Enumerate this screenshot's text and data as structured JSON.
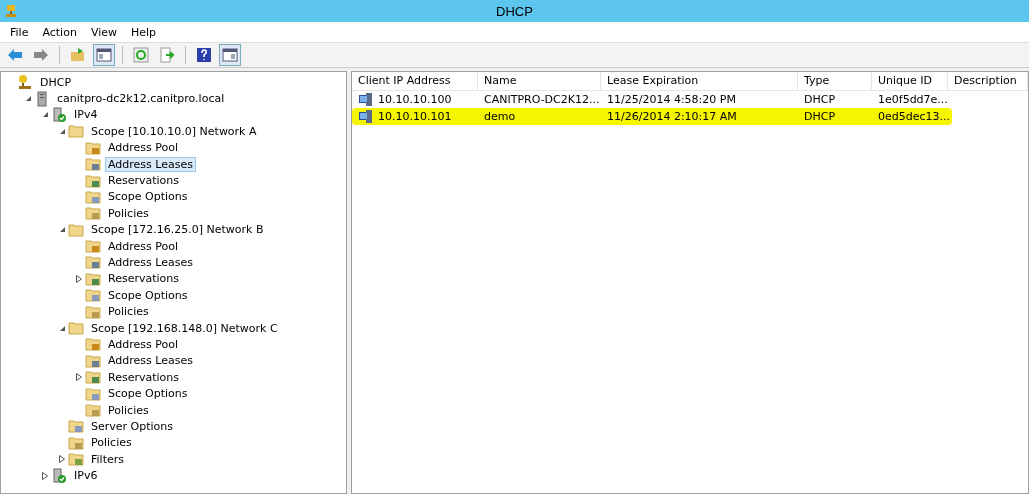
{
  "window": {
    "title": "DHCP"
  },
  "menu": [
    "File",
    "Action",
    "View",
    "Help"
  ],
  "toolbar": [
    {
      "kind": "back"
    },
    {
      "kind": "forward"
    },
    {
      "kind": "up-folder"
    },
    {
      "kind": "pane",
      "selected": true
    },
    {
      "kind": "refresh"
    },
    {
      "kind": "export"
    },
    {
      "kind": "help"
    },
    {
      "kind": "pane-right",
      "selected": true
    }
  ],
  "tree": [
    {
      "label": "DHCP",
      "kind": "dhcp",
      "selected": false,
      "children": [
        {
          "label": "canitpro-dc2k12.canitpro.local",
          "kind": "server",
          "expanded": true,
          "selected": false,
          "children": [
            {
              "label": "IPv4",
              "kind": "ip",
              "expanded": true,
              "selected": false,
              "children": [
                {
                  "label": "Scope [10.10.10.0] Network A",
                  "kind": "scope",
                  "expanded": true,
                  "selected": false,
                  "children": [
                    {
                      "label": "Address Pool",
                      "kind": "pool",
                      "selected": false
                    },
                    {
                      "label": "Address Leases",
                      "kind": "leases",
                      "selected": true
                    },
                    {
                      "label": "Reservations",
                      "kind": "reservations",
                      "selected": false
                    },
                    {
                      "label": "Scope Options",
                      "kind": "options",
                      "selected": false
                    },
                    {
                      "label": "Policies",
                      "kind": "policies",
                      "selected": false
                    }
                  ]
                },
                {
                  "label": "Scope [172.16.25.0] Network B",
                  "kind": "scope",
                  "expanded": true,
                  "selected": false,
                  "children": [
                    {
                      "label": "Address Pool",
                      "kind": "pool",
                      "selected": false
                    },
                    {
                      "label": "Address Leases",
                      "kind": "leases",
                      "selected": false
                    },
                    {
                      "label": "Reservations",
                      "kind": "reservations",
                      "expanded": false,
                      "selected": false
                    },
                    {
                      "label": "Scope Options",
                      "kind": "options",
                      "selected": false
                    },
                    {
                      "label": "Policies",
                      "kind": "policies",
                      "selected": false
                    }
                  ]
                },
                {
                  "label": "Scope [192.168.148.0] Network C",
                  "kind": "scope",
                  "expanded": true,
                  "selected": false,
                  "children": [
                    {
                      "label": "Address Pool",
                      "kind": "pool",
                      "selected": false
                    },
                    {
                      "label": "Address Leases",
                      "kind": "leases",
                      "selected": false
                    },
                    {
                      "label": "Reservations",
                      "kind": "reservations",
                      "expanded": false,
                      "selected": false
                    },
                    {
                      "label": "Scope Options",
                      "kind": "options",
                      "selected": false
                    },
                    {
                      "label": "Policies",
                      "kind": "policies",
                      "selected": false
                    }
                  ]
                },
                {
                  "label": "Server Options",
                  "kind": "options",
                  "selected": false
                },
                {
                  "label": "Policies",
                  "kind": "policies",
                  "selected": false
                },
                {
                  "label": "Filters",
                  "kind": "filters",
                  "expanded": false,
                  "selected": false
                }
              ]
            },
            {
              "label": "IPv6",
              "kind": "ip",
              "expanded": false,
              "selected": false
            }
          ]
        }
      ]
    }
  ],
  "table": {
    "columns": [
      "Client IP Address",
      "Name",
      "Lease Expiration",
      "Type",
      "Unique ID",
      "Description"
    ],
    "rows": [
      {
        "cells": [
          "10.10.10.100",
          "CANITPRO-DC2K12...",
          "11/25/2014 4:58:20 PM",
          "DHCP",
          "1e0f5dd7e..."
        ],
        "highlighted": false
      },
      {
        "cells": [
          "10.10.10.101",
          "demo",
          "11/26/2014 2:10:17 AM",
          "DHCP",
          "0ed5dec13..."
        ],
        "highlighted": true
      }
    ]
  }
}
